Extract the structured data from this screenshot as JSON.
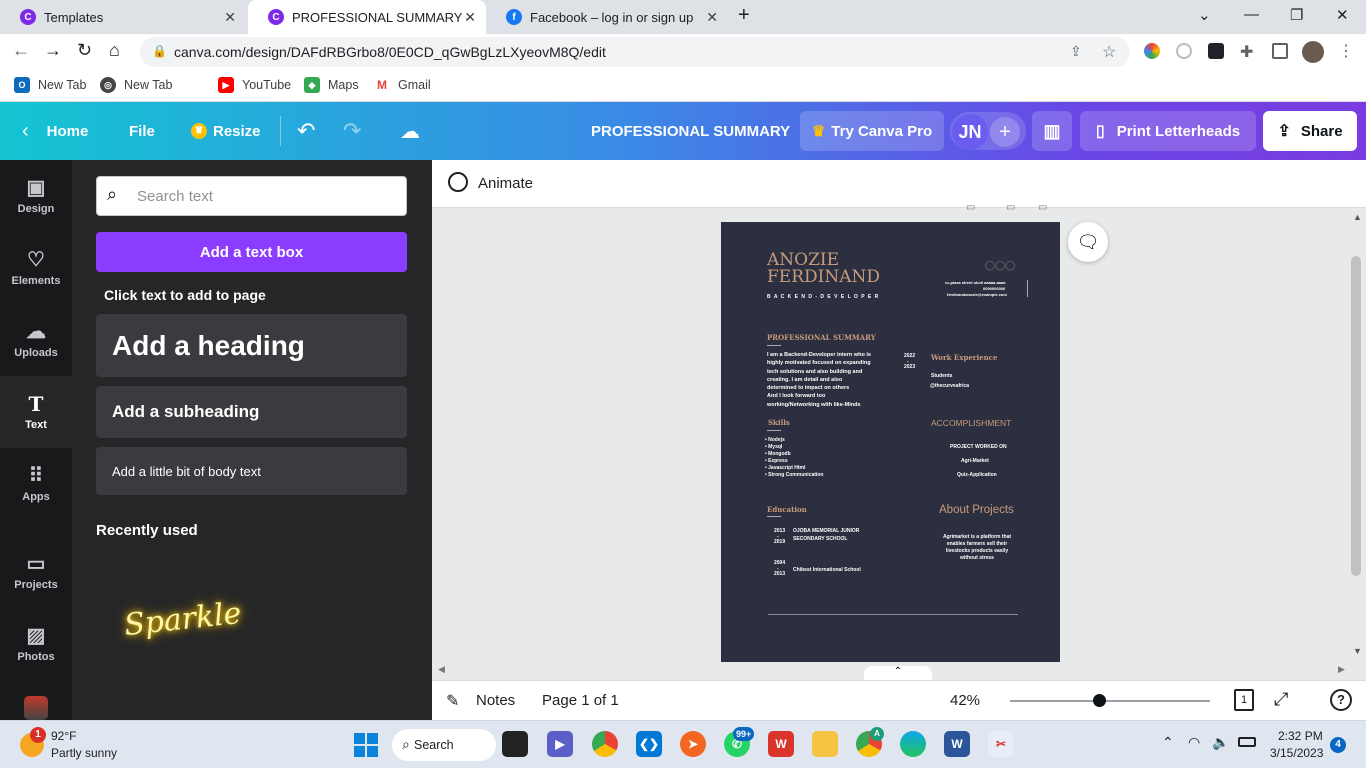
{
  "browser": {
    "tabs": [
      {
        "title": "Templates",
        "icon": "canva-icon"
      },
      {
        "title": "PROFESSIONAL SUMMARY - US",
        "icon": "canva-icon"
      },
      {
        "title": "Facebook – log in or sign up",
        "icon": "facebook-icon"
      }
    ],
    "url": "canva.com/design/DAFdRBGrbo8/0E0CD_qGwBgLzLXyeovM8Q/edit",
    "bookmarks": [
      {
        "label": "New Tab",
        "icon": "outlook-icon"
      },
      {
        "label": "New Tab",
        "icon": "globe-icon"
      },
      {
        "label": "YouTube",
        "icon": "youtube-icon"
      },
      {
        "label": "Maps",
        "icon": "maps-icon"
      },
      {
        "label": "Gmail",
        "icon": "gmail-icon"
      }
    ]
  },
  "canva_header": {
    "home": "Home",
    "file": "File",
    "resize": "Resize",
    "design_title": "PROFESSIONAL SUMMARY",
    "try_pro": "Try Canva Pro",
    "avatar_initials": "JN",
    "print": "Print Letterheads",
    "share": "Share"
  },
  "rail": [
    "Design",
    "Elements",
    "Uploads",
    "Text",
    "Apps",
    "Projects",
    "Photos"
  ],
  "text_panel": {
    "search_placeholder": "Search text",
    "add_text_box": "Add a text box",
    "click_hint": "Click text to add to page",
    "heading": "Add a heading",
    "subheading": "Add a subheading",
    "body": "Add a little bit of body text",
    "recently_used": "Recently used",
    "sparkle": "Sparkle"
  },
  "editor": {
    "animate": "Animate",
    "notes": "Notes",
    "page_indicator": "Page 1 of 1",
    "zoom": "42%",
    "page_count": "1",
    "zoom_level": 0.42
  },
  "resume": {
    "name_line1": "ANOZIE",
    "name_line2": "FERDINAND",
    "role": "B A C K E N D - D E V E L O P E R",
    "contact1": "cc,plaza street okoli aaaaa-aaaa",
    "contact2": "0000000000",
    "contact3": "ferdinandanozie@example.com",
    "summary_title": "PROFESSIONAL SUMMARY",
    "summary_lines": [
      "I am a Backend-Developer intern who is",
      "highly  motivated focused on expanding",
      "tech solutions and also building and",
      "creating.  I am detail and also",
      "determined to impact on others",
      "And I look forward too",
      "working/Networking with like-Minds"
    ],
    "work_title": "Work Experience",
    "work_year1": "2022",
    "work_year2": "2023",
    "work_role": "Students",
    "work_org": "@thecurveafrica",
    "skills_title": "Skills",
    "skills": [
      "Nodejs",
      "Mysql",
      "Mongodb",
      "Express",
      "Javascript Html",
      "Strong Communication"
    ],
    "accomplishment_title": "ACCOMPLISHMENT",
    "projects_worked": "PROJECT WORKED ON",
    "project1": "Agri-Market",
    "project2": "Quiz-Application",
    "education_title": "Education",
    "edu": [
      {
        "from": "2013",
        "to": "2019",
        "school1": "OJOBA MEMORIAL JUNIOR",
        "school2": "SECONDARY SCHOOL"
      },
      {
        "from": "2004",
        "to": "2013",
        "school1": "Chibest International School",
        "school2": ""
      }
    ],
    "about_title": "About Projects",
    "about_lines": [
      "Agrimarket is a platform that",
      "enables farmers sell their",
      "livestocks products easily",
      "without stress"
    ]
  },
  "taskbar": {
    "weather_temp": "92°F",
    "weather_desc": "Partly sunny",
    "weather_badge": "1",
    "search": "Search",
    "whatsapp_badge": "99+",
    "chrome_badge": "A",
    "time": "2:32 PM",
    "date": "3/15/2023",
    "notif": "4"
  },
  "colors": {
    "canva_purple": "#8b3dff",
    "resume_bg": "#2c2f40",
    "resume_accent": "#c79b7a"
  }
}
